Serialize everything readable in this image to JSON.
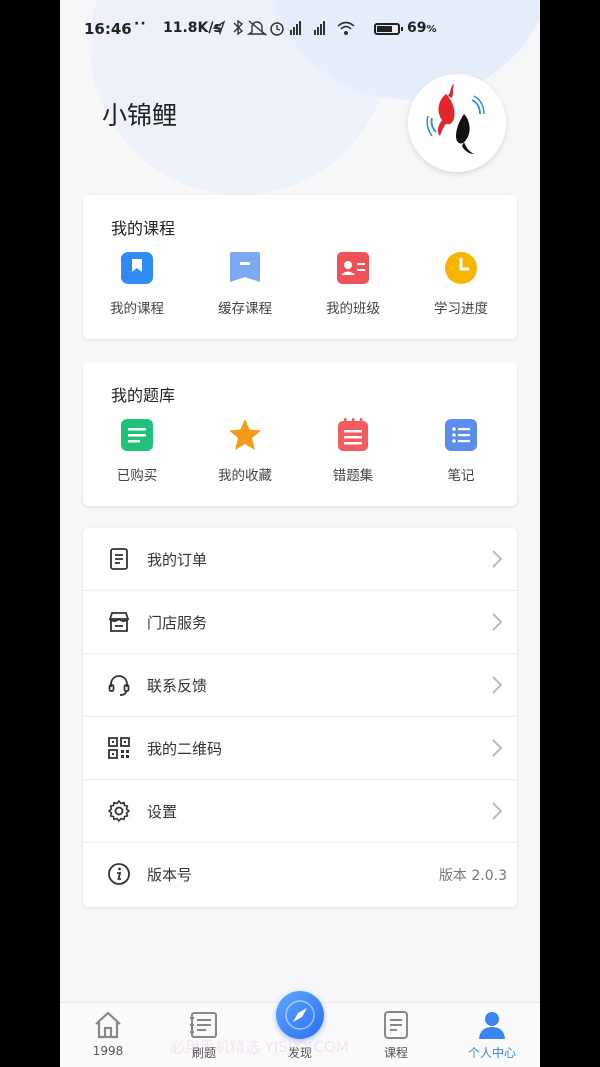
{
  "status_bar": {
    "time": "16:46",
    "dots": "··",
    "net_speed": "11.8K/s",
    "battery_pct": "69",
    "battery_unit": "%"
  },
  "profile": {
    "name": "小锦鲤"
  },
  "my_courses": {
    "title": "我的课程",
    "items": [
      {
        "label": "我的课程",
        "icon": "bookmark-icon",
        "color": "#2f8cf5"
      },
      {
        "label": "缓存课程",
        "icon": "cache-icon",
        "color": "#7da8f2"
      },
      {
        "label": "我的班级",
        "icon": "id-card-icon",
        "color": "#f0525a"
      },
      {
        "label": "学习进度",
        "icon": "clock-icon",
        "color": "#f7b500"
      }
    ]
  },
  "my_question_bank": {
    "title": "我的题库",
    "items": [
      {
        "label": "已购买",
        "icon": "document-icon",
        "color": "#20c27a"
      },
      {
        "label": "我的收藏",
        "icon": "star-icon",
        "color": "#f59a1b"
      },
      {
        "label": "错题集",
        "icon": "notebook-icon",
        "color": "#f25c5c"
      },
      {
        "label": "笔记",
        "icon": "list-icon",
        "color": "#5b8def"
      }
    ]
  },
  "menu": {
    "items": [
      {
        "label": "我的订单",
        "icon": "order-icon"
      },
      {
        "label": "门店服务",
        "icon": "store-icon"
      },
      {
        "label": "联系反馈",
        "icon": "headset-icon"
      },
      {
        "label": "我的二维码",
        "icon": "qrcode-icon"
      },
      {
        "label": "设置",
        "icon": "gear-icon"
      },
      {
        "label": "版本号",
        "icon": "info-icon",
        "value": "版本 2.0.3"
      }
    ]
  },
  "tabbar": {
    "items": [
      {
        "label": "1998",
        "icon": "home-icon"
      },
      {
        "label": "刷题",
        "icon": "practice-icon"
      },
      {
        "label": "发现",
        "icon": "compass-icon"
      },
      {
        "label": "课程",
        "icon": "course-icon"
      },
      {
        "label": "个人中心",
        "icon": "person-icon",
        "active": true
      }
    ],
    "active_color": "#3a86f0"
  },
  "watermark": "必用手机精选 YJSJXY.COM"
}
